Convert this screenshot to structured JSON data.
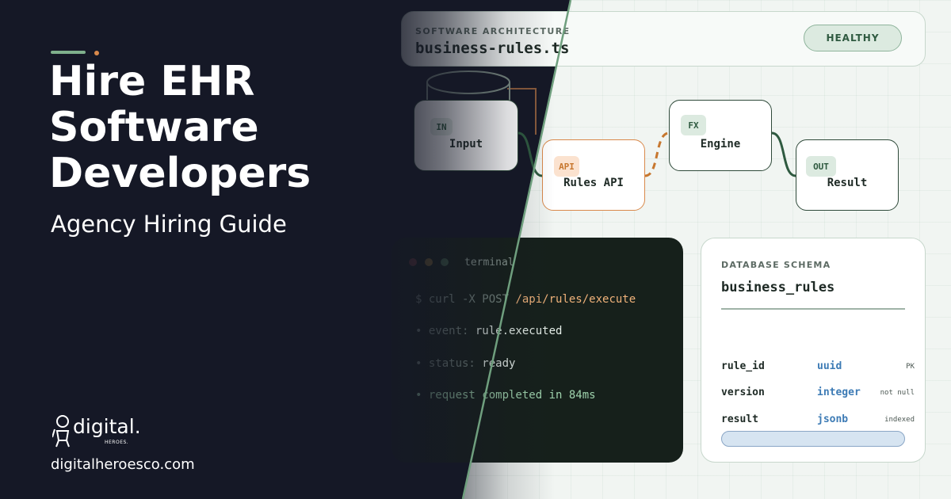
{
  "header": {
    "eyebrow": "SOFTWARE ARCHITECTURE",
    "filename": "business-rules.ts",
    "status_badge": "HEALTHY"
  },
  "flow": {
    "nodes": [
      {
        "tag": "IN",
        "label": "Input"
      },
      {
        "tag": "API",
        "label": "Rules API"
      },
      {
        "tag": "FX",
        "label": "Engine"
      },
      {
        "tag": "OUT",
        "label": "Result"
      }
    ]
  },
  "terminal": {
    "title": "terminal",
    "lines": [
      {
        "prefix": "$ curl -X POST ",
        "text": "/api/rules/execute"
      },
      {
        "prefix": "• event: ",
        "text": "rule.executed"
      },
      {
        "prefix": "• status: ",
        "text": "ready"
      },
      {
        "prefix": "• request completed in 84ms",
        "text": ""
      }
    ]
  },
  "schema": {
    "eyebrow": "DATABASE SCHEMA",
    "table_name": "business_rules",
    "columns": [
      {
        "name": "rule_id",
        "type": "uuid",
        "flag": "PK"
      },
      {
        "name": "version",
        "type": "integer",
        "flag": "not null"
      },
      {
        "name": "result",
        "type": "jsonb",
        "flag": "indexed"
      }
    ]
  },
  "hero": {
    "title_lines": [
      "Hire EHR",
      "Software",
      "Developers"
    ],
    "subtitle": "Agency Hiring Guide"
  },
  "brand": {
    "logo_word": "digital.",
    "logo_sub": "HEROES.",
    "url": "digitalheroesco.com"
  },
  "colors": {
    "background_dark": "#151826",
    "panel_light": "#f1f5f2",
    "accent_green": "#7fb08c",
    "accent_orange": "#d9894b",
    "type_blue": "#3d7bb5"
  }
}
